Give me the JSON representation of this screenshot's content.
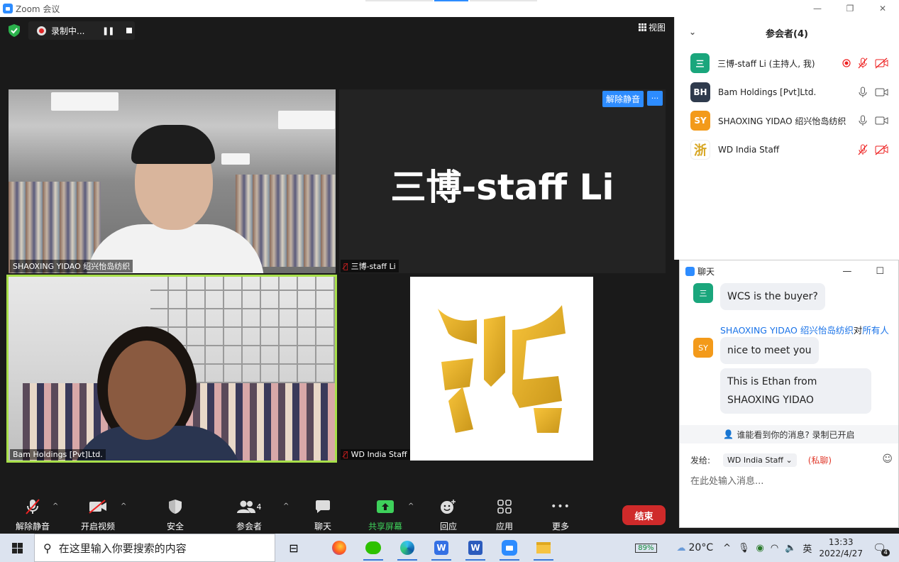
{
  "window": {
    "title": "Zoom 会议",
    "minimize": "—",
    "restore": "❐",
    "close": "✕"
  },
  "recording": {
    "label": "录制中..."
  },
  "view_button": {
    "label": "视图"
  },
  "tiles": [
    {
      "name": "SHAOXING YIDAO  绍兴怡岛纺织",
      "muted": false
    },
    {
      "name": "三博-staff Li",
      "muted": true,
      "display_name": "三博-staff Li",
      "unmute_label": "解除静音",
      "more_label": "···"
    },
    {
      "name": "Bam Holdings [Pvt]Ltd.",
      "muted": false,
      "active_speaker": true
    },
    {
      "name": "WD India Staff",
      "muted": true
    }
  ],
  "toolbar": {
    "items": [
      {
        "label": "解除静音",
        "icon": "mic-off-icon"
      },
      {
        "label": "开启视频",
        "icon": "video-off-icon"
      },
      {
        "label": "安全",
        "icon": "shield-icon"
      },
      {
        "label": "参会者",
        "icon": "participants-icon",
        "count": "4"
      },
      {
        "label": "聊天",
        "icon": "chat-icon"
      },
      {
        "label": "共享屏幕",
        "icon": "share-screen-icon"
      },
      {
        "label": "回应",
        "icon": "reaction-icon"
      },
      {
        "label": "应用",
        "icon": "apps-icon"
      },
      {
        "label": "更多",
        "icon": "more-icon",
        "glyph": "•••"
      }
    ],
    "end_label": "结束"
  },
  "participants": {
    "title": "参会者(4)",
    "list": [
      {
        "initials": "三",
        "name": "三博-staff Li (主持人, 我)",
        "color": "#1aa67c",
        "recording": true,
        "mic_muted": true,
        "video_off": true
      },
      {
        "initials": "BH",
        "name": "Bam Holdings [Pvt]Ltd.",
        "color": "#2f3b4d",
        "mic_muted": false,
        "video_off": false
      },
      {
        "initials": "SY",
        "name": "SHAOXING YIDAO  绍兴怡岛纺织",
        "color": "#f39a1a",
        "mic_muted": false,
        "video_off": false
      },
      {
        "initials": "浙",
        "name": "WD India Staff",
        "color": "#ffffff",
        "mic_muted": true,
        "video_off": true
      }
    ]
  },
  "chat": {
    "title": "聊天",
    "messages": [
      {
        "avatar": "三",
        "avatar_color": "#1aa67c",
        "text": "WCS is the buyer?"
      },
      {
        "avatar": "SY",
        "avatar_color": "#f39a1a",
        "sender": "SHAOXING YIDAO  绍兴怡岛纺织",
        "to_label": "对",
        "recipient": "所有人",
        "texts": [
          "nice to meet you",
          "This is Ethan from SHAOXING YIDAO"
        ]
      }
    ],
    "who_sees": "谁能看到你的消息? 录制已开启",
    "send_to_label": "发给:",
    "send_to_value": "WD India Staff",
    "private_label": "(私聊)",
    "input_placeholder": "在此处输入消息..."
  },
  "taskbar": {
    "search_placeholder": "在这里输入你要搜索的内容",
    "battery": "89%",
    "weather": "20°C",
    "ime": "英",
    "time": "13:33",
    "date": "2022/4/27",
    "notifications": "4"
  }
}
